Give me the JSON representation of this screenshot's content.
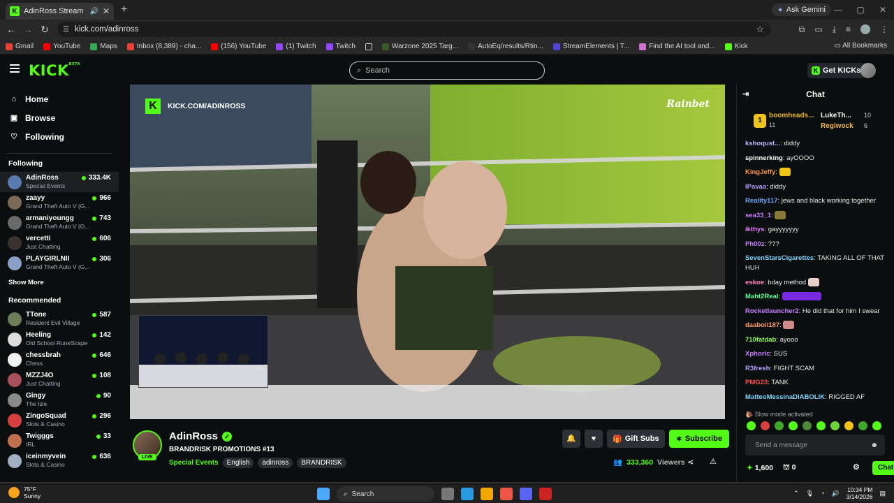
{
  "browser": {
    "tab_title": "AdinRoss Stream - Watch L",
    "url": "kick.com/adinross",
    "gemini": "Ask Gemini",
    "bookmarks": [
      "Gmail",
      "YouTube",
      "Maps",
      "Inbox (8,389) - cha...",
      "(156) YouTube",
      "(1) Twitch",
      "Twitch",
      "Warzone 2025 Targ...",
      "AutoEq/results/Rtin...",
      "StreamElements | T...",
      "Find the AI tool and...",
      "Kick"
    ],
    "all_bookmarks": "All Bookmarks"
  },
  "header": {
    "logo": "KICK",
    "logo_sup": "BETA",
    "search_placeholder": "Search",
    "get_kicks": "Get KICKs"
  },
  "sidebar": {
    "nav": [
      {
        "label": "Home",
        "icon": "home-icon"
      },
      {
        "label": "Browse",
        "icon": "browse-icon"
      },
      {
        "label": "Following",
        "icon": "heart-icon"
      }
    ],
    "following_header": "Following",
    "following": [
      {
        "name": "AdinRoss",
        "category": "Special Events",
        "viewers": "333.4K",
        "color": "#5b7bb0"
      },
      {
        "name": "zaayy",
        "category": "Grand Theft Auto V (G...",
        "viewers": "966",
        "color": "#7c6a58"
      },
      {
        "name": "armaniyoungg",
        "category": "Grand Theft Auto V (G...",
        "viewers": "743",
        "color": "#6a6a6a"
      },
      {
        "name": "vercetti",
        "category": "Just Chatting",
        "viewers": "606",
        "color": "#3a3030"
      },
      {
        "name": "PLAYGIRLNII",
        "category": "Grand Theft Auto V (G...",
        "viewers": "306",
        "color": "#8aa0c8"
      }
    ],
    "show_more": "Show More",
    "recommended_header": "Recommended",
    "recommended": [
      {
        "name": "TTone",
        "category": "Resident Evil Village",
        "viewers": "587",
        "color": "#6b7e58"
      },
      {
        "name": "Heeling",
        "category": "Old School RuneScape",
        "viewers": "142",
        "color": "#dcdcdc"
      },
      {
        "name": "chessbrah",
        "category": "Chess",
        "viewers": "646",
        "color": "#f2f2f2"
      },
      {
        "name": "MZZJ4O",
        "category": "Just Chatting",
        "viewers": "108",
        "color": "#a8505a"
      },
      {
        "name": "Gingy",
        "category": "The Isle",
        "viewers": "90",
        "color": "#8a8a8a"
      },
      {
        "name": "ZingoSquad",
        "category": "Slots & Casino",
        "viewers": "296",
        "color": "#d84040"
      },
      {
        "name": "Twigggs",
        "category": "IRL",
        "viewers": "33",
        "color": "#c07050"
      },
      {
        "name": "iceinmyvein",
        "category": "Slots & Casino",
        "viewers": "636",
        "color": "#a0b0c0"
      }
    ]
  },
  "video": {
    "overlay_url": "KICK.COM/ADINROSS",
    "sponsor": "Rainbet"
  },
  "stream": {
    "streamer": "AdinRoss",
    "live": "LIVE",
    "title": "BRANDRISK PROMOTIONS #13",
    "category": "Special Events",
    "tags": [
      "English",
      "adinross",
      "BRANDRISK"
    ],
    "gift_subs": "Gift Subs",
    "subscribe": "Subscribe",
    "viewers": "333,360",
    "viewers_label": "Viewers"
  },
  "chat": {
    "title": "Chat",
    "leaderboard": [
      {
        "rank": "1",
        "name": "boomheads...",
        "count": "11"
      },
      {
        "name": "LukeTh...",
        "count": "10"
      },
      {
        "name": "Regiwock",
        "count": "6"
      }
    ],
    "messages": [
      {
        "user": "kshoqust...",
        "text": "diddy",
        "color": "#b8b8ff"
      },
      {
        "user": "spinnerking",
        "text": "ayOOOO",
        "color": "#ffffff"
      },
      {
        "user": "KingJeffy",
        "text": "",
        "color": "#ff9a3c"
      },
      {
        "user": "IPavaa",
        "text": "diddy",
        "color": "#b49cff"
      },
      {
        "user": "Reality117",
        "text": "jews and black working together",
        "color": "#6ea8ff"
      },
      {
        "user": "sea33_1",
        "text": "",
        "color": "#c77dff"
      },
      {
        "user": "ikthys",
        "text": "gayyyyyyy",
        "color": "#e07cff"
      },
      {
        "user": "Ph00z",
        "text": "???",
        "color": "#c77dff"
      },
      {
        "user": "SevenStarsCigarettes",
        "text": "TAKING ALL OF THAT HUH",
        "color": "#7fd4ff"
      },
      {
        "user": "eskoe",
        "text": "bday method",
        "color": "#ff80c0"
      },
      {
        "user": "Maht2Real",
        "text": "",
        "color": "#5dff9a"
      },
      {
        "user": "Rocketlauncher2",
        "text": "He did that for him I swear",
        "color": "#c77dff"
      },
      {
        "user": "daaboii187",
        "text": "",
        "color": "#ff9a6a"
      },
      {
        "user": "710fatdab",
        "text": "ayooo",
        "color": "#8cff5a"
      },
      {
        "user": "Xphoric",
        "text": "SUS",
        "color": "#c77dff"
      },
      {
        "user": "R3fresh",
        "text": "FIGHT SCAM",
        "color": "#b49cff"
      },
      {
        "user": "PMG23",
        "text": "TANK",
        "color": "#ff4d4d"
      },
      {
        "user": "MatteoMessinaDIABOLIK",
        "text": "RIGGED AF",
        "color": "#7fd4ff"
      }
    ],
    "slow_mode": "Slow mode activated",
    "send_placeholder": "Send a message",
    "points": "1,600",
    "count": "0",
    "chat_button": "Chat"
  },
  "taskbar": {
    "temp": "75°F",
    "weather": "Sunny",
    "search": "Search",
    "time": "10:34 PM",
    "date": "3/14/2026"
  }
}
